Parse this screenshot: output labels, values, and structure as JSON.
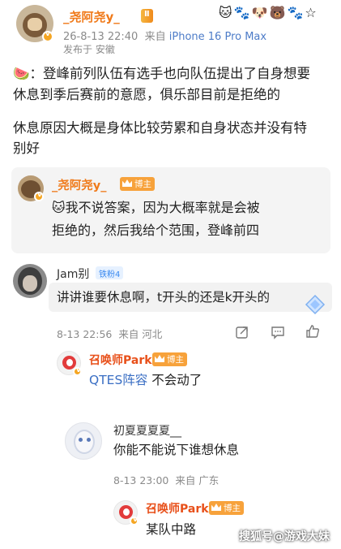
{
  "post": {
    "author": "_尧阿尧y_",
    "level": "Ⅱ",
    "time": "26-8-13 22:40",
    "from_prefix": "来自",
    "device": "iPhone 16 Pro Max",
    "location": "发布于 安徽",
    "line1": "🍉：登峰前列队伍有选手也向队伍提出了自身想要",
    "line2": "休息到季后赛前的意愿，俱乐部目前是拒绝的",
    "line3": "休息原因大概是身体比较劳累和自身状态并没有特",
    "line4": "别好"
  },
  "top_icons": [
    "🐱",
    "🐾",
    "🐶",
    "🐻",
    "🐾",
    "☆"
  ],
  "author_reply": {
    "name": "_尧阿尧y_",
    "badge": "博主",
    "line1": "🐱我不说答案，因为大概率就是会被",
    "line2": "拒绝的，然后我给个范围，登峰前四"
  },
  "comment_jam": {
    "name": "Jam别",
    "fan_badge": "铁粉4",
    "text": "讲讲谁要休息啊，t开头的还是k开头的",
    "time": "8-13 22:56",
    "location": "来自 河北"
  },
  "reply_park_1": {
    "name": "召唤师Park",
    "badge": "博主",
    "link": "QTES阵容",
    "text": " 不会动了"
  },
  "comment_xia": {
    "name": "初夏夏夏夏__",
    "text": "你能不能说下谁想休息",
    "time": "8-13 23:00",
    "location": "来自 广东"
  },
  "reply_park_2": {
    "name": "召唤师Park",
    "badge": "博主",
    "text": "某队中路"
  },
  "watermark": "搜狐号@游戏大妹",
  "colors": {
    "name_orange": "#f07a1a",
    "meta_grey": "#8a8a8a",
    "device_blue": "#4d7cc8",
    "badge_orange": "#f7a23b"
  }
}
